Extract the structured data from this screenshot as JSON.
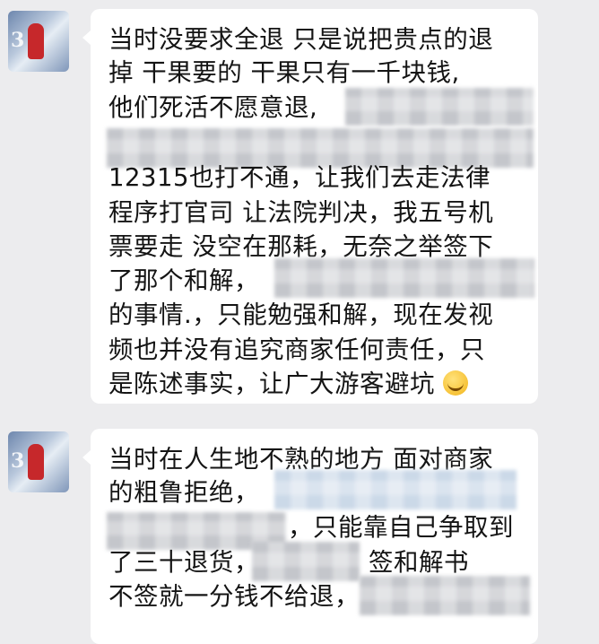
{
  "messages": [
    {
      "lines": [
        "当时没要求全退 只是说把贵点的退",
        "掉 干果要的 干果只有一千块钱,",
        "他们死活不愿意退,",
        "",
        "12315也打不通，让我们去走法律",
        "程序打官司 让法院判决，我五号机",
        "票要走 没空在那耗，无奈之举签下",
        "了那个和解，",
        "的事情.，只能勉强和解，现在发视",
        "频也并没有追究商家任何责任，只",
        "是陈述事实，让广大游客避坑"
      ],
      "emoji": "crying-laughing-emoji"
    },
    {
      "lines": [
        "当时在人生地不熟的地方 面对商家",
        "的粗鲁拒绝，",
        "，只能靠自己争取到",
        "了三十退货，",
        "签和解书",
        "不签就一分钱不给退，"
      ]
    }
  ]
}
